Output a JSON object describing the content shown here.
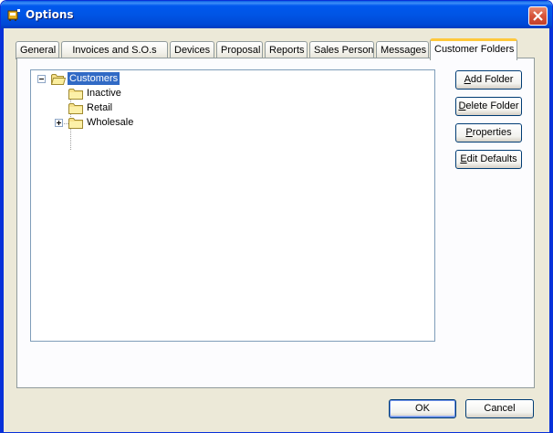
{
  "window": {
    "title": "Options",
    "colors": {
      "title_bar": "#0055e5",
      "face": "#ece9d8",
      "selection": "#316ac5",
      "active_tab_accent": "#ffc83c"
    }
  },
  "tabs": [
    {
      "label": "General"
    },
    {
      "label": "Invoices and S.O.s"
    },
    {
      "label": "Devices"
    },
    {
      "label": "Proposal"
    },
    {
      "label": "Reports"
    },
    {
      "label": "Sales Person"
    },
    {
      "label": "Messages"
    },
    {
      "label": "Customer Folders",
      "active": true
    }
  ],
  "tree": {
    "root": {
      "label": "Customers",
      "expanded": true,
      "selected": true
    },
    "children": [
      {
        "label": "Inactive",
        "has_children": false
      },
      {
        "label": "Retail",
        "has_children": false
      },
      {
        "label": "Wholesale",
        "has_children": true,
        "expanded": false
      }
    ]
  },
  "side_buttons": {
    "add_folder": {
      "mnemonic": "A",
      "rest": "dd Folder"
    },
    "delete_folder": {
      "mnemonic": "D",
      "rest": "elete Folder"
    },
    "properties": {
      "mnemonic": "P",
      "rest": "roperties"
    },
    "edit_defaults": {
      "mnemonic": "E",
      "rest": "dit Defaults"
    }
  },
  "footer": {
    "ok_label": "OK",
    "cancel_label": "Cancel"
  }
}
